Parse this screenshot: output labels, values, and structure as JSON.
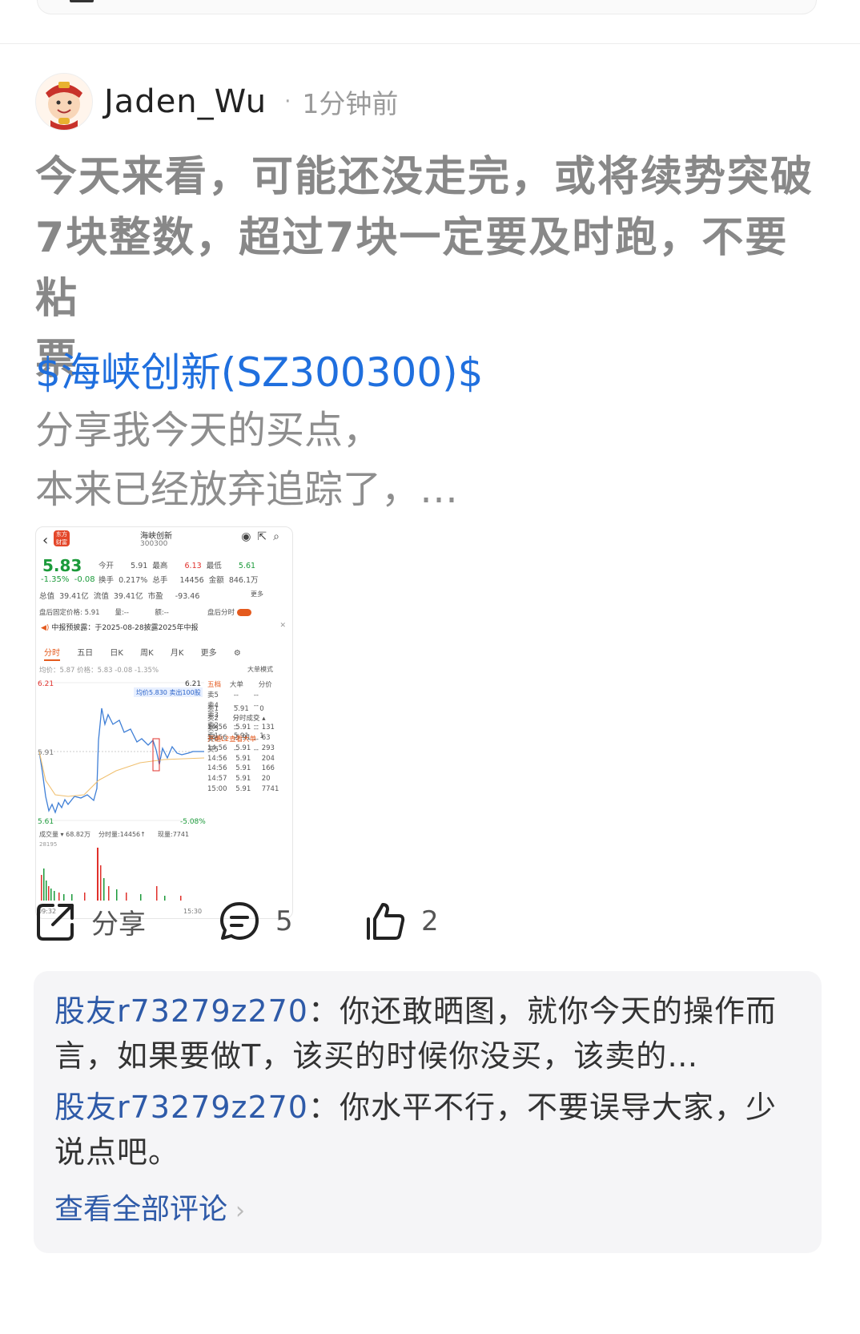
{
  "post": {
    "author": "Jaden_Wu",
    "time": "1分钟前",
    "body_lines": [
      "今天来看，可能还没走完，或将续势突破",
      "7块整数，超过7块一定要及时跑，不要粘",
      "票"
    ],
    "stock_link": "$海峡创新(SZ300300)$",
    "share_lines": [
      "分享我今天的买点，",
      "本来已经放弃追踪了，…"
    ]
  },
  "thumbnail": {
    "stock_name": "海峡创新",
    "stock_code": "300300",
    "price": "5.83",
    "change_pct": "-1.35%",
    "change": "-0.08",
    "open_label": "今开",
    "open": "5.91",
    "high_label": "最高",
    "high": "6.13",
    "low_label": "最低",
    "low": "5.61",
    "turnover_label": "换手",
    "turnover": "0.217%",
    "volume_label": "总手",
    "volume": "14456",
    "amount_label": "金额",
    "amount": "846.1万",
    "mcap_label": "总值",
    "mcap": "39.41亿",
    "float_label": "流值",
    "float_mcap": "39.41亿",
    "pe_label": "市盈",
    "pe": "-93.46",
    "more": "更多",
    "after_hours_price_label": "盘后固定价格:",
    "after_hours_price": "5.91",
    "qty_label": "量:--",
    "amt_label": "额:--",
    "after_hours_switch": "盘后分时",
    "notice": "中报预披露：于2025-08-28披露2025年中报",
    "tabs": [
      "分时",
      "五日",
      "日K",
      "周K",
      "月K",
      "更多"
    ],
    "avg_line": "均价：5.87 价格：5.83 -0.08 -1.35%",
    "big_order_mode": "大单模式",
    "axis_top": "6.21",
    "axis_top_right": "6.21",
    "axis_mid": "5.91",
    "axis_low": "5.61",
    "axis_low_pct": "-5.08%",
    "tooltip": "均价5.830 卖出100股",
    "vol_label": "成交量 ▾ 68.82万",
    "tick_vol_label": "分时量:14456↑",
    "now_vol_label": "现量:7741",
    "vol_max": "28195",
    "time_start": "09:32",
    "time_end": "15:30",
    "book_headers": [
      "五档",
      "大单",
      "分价"
    ],
    "asks": [
      [
        "卖5",
        "--",
        "--"
      ],
      [
        "卖4",
        "--",
        "--"
      ],
      [
        "卖3",
        "--",
        "--"
      ],
      [
        "卖2",
        "--",
        "--"
      ],
      [
        "卖1",
        "5.91",
        "1"
      ]
    ],
    "bids": [
      [
        "买1",
        "5.91",
        "0"
      ],
      [
        "买2",
        "--",
        "--"
      ],
      [
        "买3",
        "--",
        "--"
      ],
      [
        "买4",
        "--",
        "--"
      ],
      [
        "买5",
        "--",
        "--"
      ]
    ],
    "ticks_label": "分时成交 ▴",
    "ticks": [
      [
        "14:56",
        "5.91",
        "131"
      ],
      [
        "14:56",
        "5.91",
        "63"
      ],
      [
        "14:56",
        "5.91",
        "293"
      ],
      [
        "14:56",
        "5.91",
        "204"
      ],
      [
        "14:56",
        "5.91",
        "166"
      ],
      [
        "14:57",
        "5.91",
        "20"
      ],
      [
        "15:00",
        "5.91",
        "7741"
      ]
    ],
    "level2": "开通L2查看大单"
  },
  "actions": {
    "share": "分享",
    "comments": "5",
    "likes": "2"
  },
  "comments": [
    {
      "user": "股友r73279z270",
      "text": "：你还敢晒图，就你今天的操作而言，如果要做T，该买的时候你没买，该卖的…"
    },
    {
      "user": "股友r73279z270",
      "text": "：你水平不行，不要误导大家，少说点吧。"
    }
  ],
  "see_all": "查看全部评论",
  "colors": {
    "link": "#1f6fde",
    "comment_user": "#2e5aa8",
    "up": "#e0302b",
    "down": "#1b9a3a"
  }
}
